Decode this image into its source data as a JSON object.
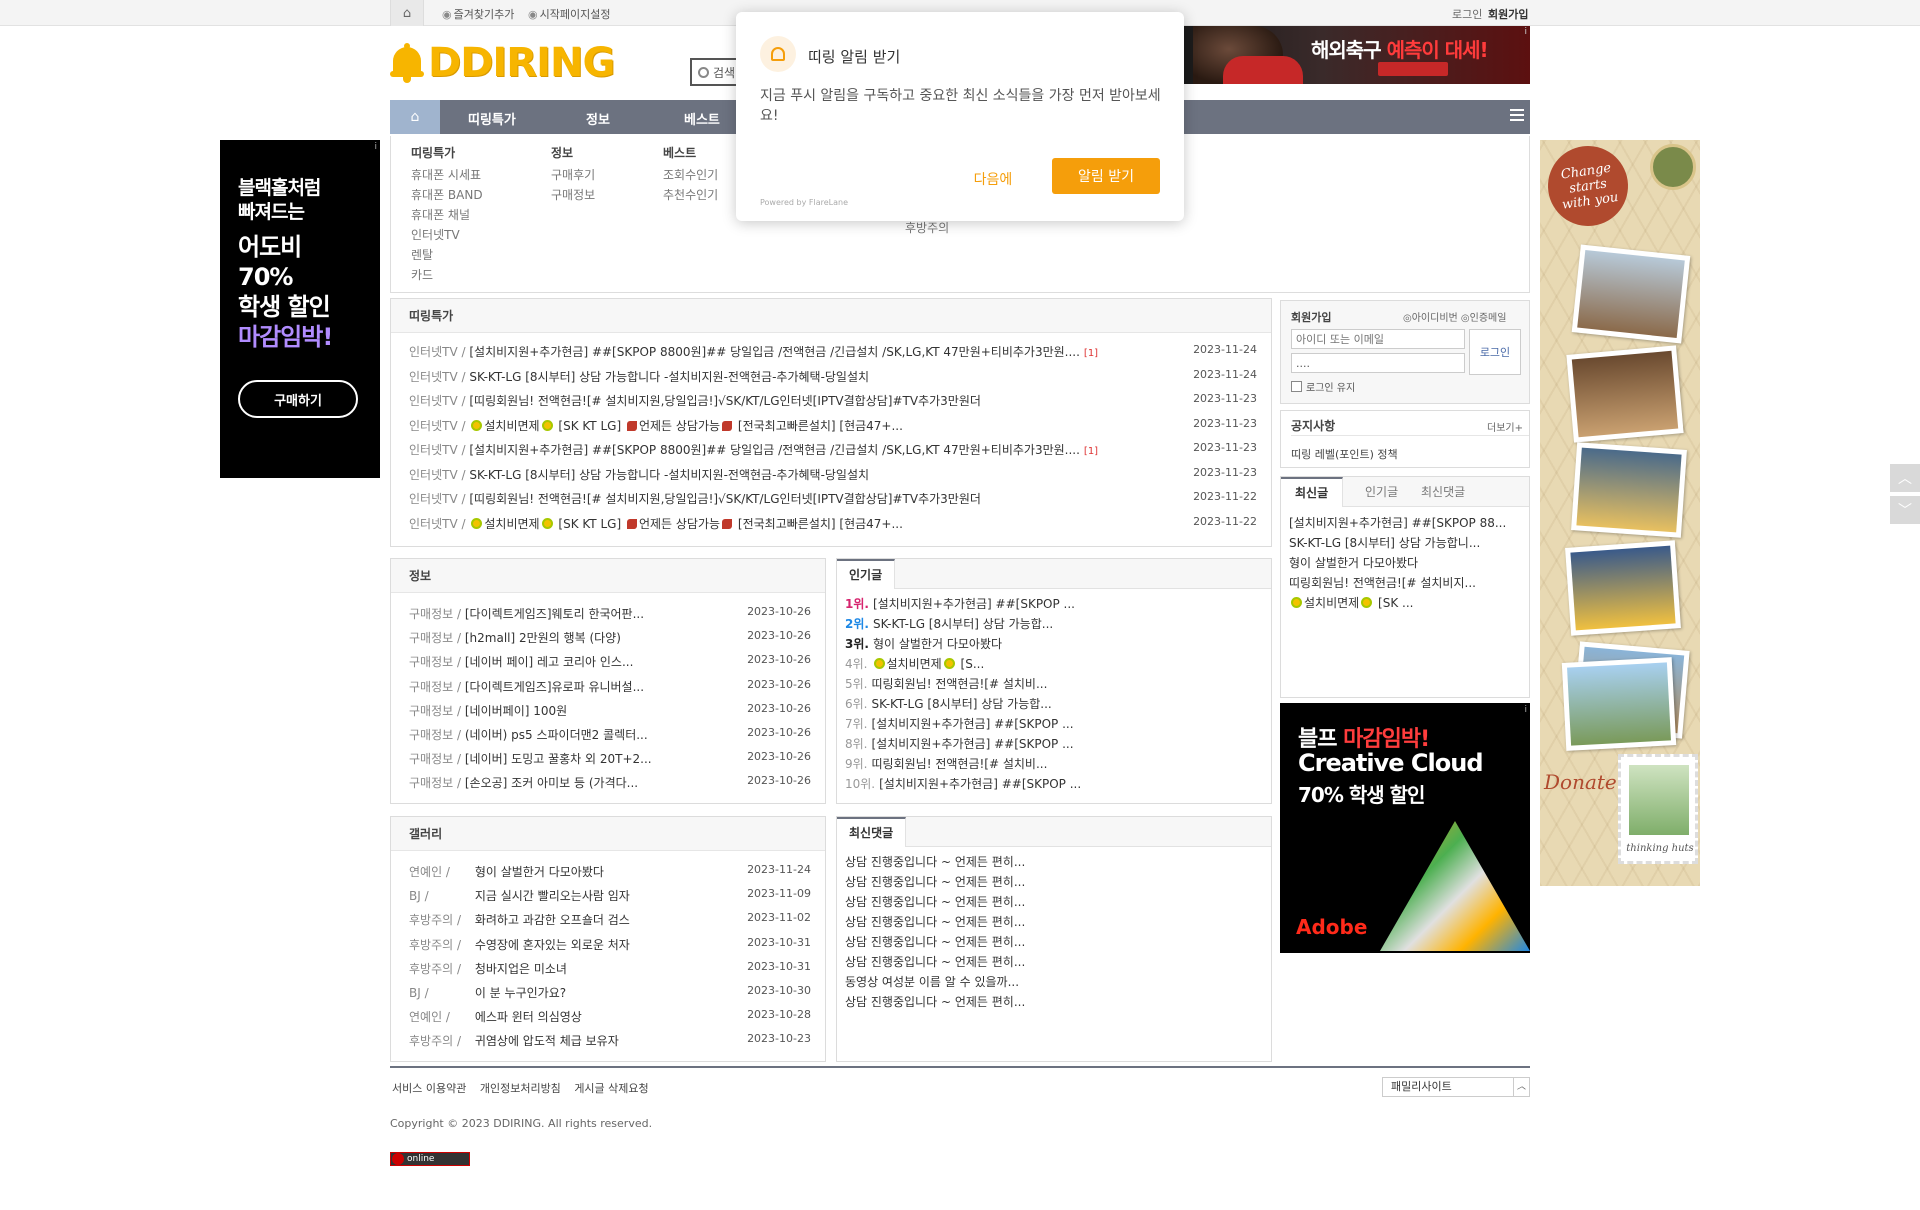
{
  "topbar": {
    "bookmark": "즐겨찾기추가",
    "startpage": "시작페이지설정",
    "login": "로그인",
    "join": "회원가입"
  },
  "logo": {
    "text": "DDIRING"
  },
  "search": {
    "placeholder": "검색"
  },
  "top_banner": {
    "text_white": "해외축구",
    "text_red": "예측이 대세!"
  },
  "nav": {
    "items": [
      "띠링특가",
      "정보",
      "베스트"
    ]
  },
  "mega_menu": {
    "columns": [
      {
        "heading": "띠링특가",
        "items": [
          "휴대폰 시세표",
          "휴대폰 BAND",
          "휴대폰 채널",
          "인터넷TV",
          "렌탈",
          "카드"
        ]
      },
      {
        "heading": "정보",
        "items": [
          "구매후기",
          "구매정보"
        ]
      },
      {
        "heading": "베스트",
        "items": [
          "조회수인기",
          "추천수인기"
        ]
      },
      {
        "heading": "",
        "items": [
          "후방주의"
        ]
      }
    ]
  },
  "popup": {
    "title": "띠링 알림 받기",
    "description": "지금 푸시 알림을 구독하고 중요한 최신 소식들을 가장 먼저 받아보세요!",
    "later": "다음에",
    "accept": "알림 받기",
    "powered": "Powered by FlareLane"
  },
  "ad_left": {
    "line1": "블랙홀처럼",
    "line2": "빠져드는",
    "line3": "어도비",
    "line4": "70%",
    "line5": "학생 할인",
    "line6": "마감임박!",
    "button": "구매하기"
  },
  "ad_right": {
    "seal": "Change starts with you",
    "donate": "Donate",
    "brand": "thinking huts"
  },
  "deals": {
    "title": "띠링특가",
    "rows": [
      {
        "cat": "인터넷TV /",
        "title": "[설치비지원+추가현금] ##[SKPOP 8800원]## 당일입금 /전액현금 /긴급설치 /SK,LG,KT 47만원+티비추가3만원....",
        "cmt": "[1]",
        "date": "2023-11-24"
      },
      {
        "cat": "인터넷TV /",
        "title": "SK-KT-LG [8시부터] 상담 가능합니다 -설치비지원-전액현금-추가혜택-당일설치",
        "cmt": "",
        "date": "2023-11-24"
      },
      {
        "cat": "인터넷TV /",
        "title": "[띠링회원님! 전액현금![# 설치비지원,당일입금!]√SK/KT/LG인터넷[IPTV결합상담]#TV추가3만원더",
        "cmt": "",
        "date": "2023-11-23"
      },
      {
        "cat": "인터넷TV /",
        "pre": "설치비면제",
        "title": "[SK KT LG]",
        "phone": "언제든 상담가능",
        "post": "[전국최고빠른설치] [현금47+...",
        "cmt": "",
        "date": "2023-11-23"
      },
      {
        "cat": "인터넷TV /",
        "title": "[설치비지원+추가현금] ##[SKPOP 8800원]## 당일입금 /전액현금 /긴급설치 /SK,LG,KT 47만원+티비추가3만원....",
        "cmt": "[1]",
        "date": "2023-11-23"
      },
      {
        "cat": "인터넷TV /",
        "title": "SK-KT-LG [8시부터] 상담 가능합니다 -설치비지원-전액현금-추가혜택-당일설치",
        "cmt": "",
        "date": "2023-11-23"
      },
      {
        "cat": "인터넷TV /",
        "title": "[띠링회원님! 전액현금![# 설치비지원,당일입금!]√SK/KT/LG인터넷[IPTV결합상담]#TV추가3만원더",
        "cmt": "",
        "date": "2023-11-22"
      },
      {
        "cat": "인터넷TV /",
        "pre": "설치비면제",
        "title": "[SK KT LG]",
        "phone": "언제든 상담가능",
        "post": "[전국최고빠른설치] [현금47+...",
        "cmt": "",
        "date": "2023-11-22"
      }
    ]
  },
  "info": {
    "title": "정보",
    "rows": [
      {
        "cat": "구매정보 /",
        "title": "[다이렉트게임즈]웨토리 한국어판...",
        "date": "2023-10-26"
      },
      {
        "cat": "구매정보 /",
        "title": "[h2mall] 2만원의 행복 (다양)",
        "date": "2023-10-26"
      },
      {
        "cat": "구매정보 /",
        "title": "[네이버 페이] 레고 코리아 인스...",
        "date": "2023-10-26"
      },
      {
        "cat": "구매정보 /",
        "title": "[다이렉트게임즈]유로파 유니버설...",
        "date": "2023-10-26"
      },
      {
        "cat": "구매정보 /",
        "title": "[네이버페이] 100원",
        "date": "2023-10-26"
      },
      {
        "cat": "구매정보 /",
        "title": "(네이버) ps5 스파이더맨2 콜렉터...",
        "date": "2023-10-26"
      },
      {
        "cat": "구매정보 /",
        "title": "[네이버] 도밍고 꿀홍차 외 20T+2...",
        "date": "2023-10-26"
      },
      {
        "cat": "구매정보 /",
        "title": "[손오공] 조커 아미보 등 (가격다...",
        "date": "2023-10-26"
      }
    ]
  },
  "popular": {
    "title": "인기글",
    "rows": [
      {
        "no": "1위.",
        "title": "[설치비지원+추가현금] ##[SKPOP ...",
        "color": "#d6246e"
      },
      {
        "no": "2위.",
        "title": "SK-KT-LG [8시부터] 상담 가능합...",
        "color": "#1e88e5"
      },
      {
        "no": "3위.",
        "title": "형이 살벌한거 다모아봤다",
        "color": "#222222"
      },
      {
        "no": "4위.",
        "pre": "설치비면제",
        "title": "[S...",
        "color": "#999999"
      },
      {
        "no": "5위.",
        "title": "띠링회원님! 전액현금![# 설치비...",
        "color": "#999999"
      },
      {
        "no": "6위.",
        "title": "SK-KT-LG [8시부터] 상담 가능합...",
        "color": "#999999"
      },
      {
        "no": "7위.",
        "title": "[설치비지원+추가현금] ##[SKPOP ...",
        "color": "#999999"
      },
      {
        "no": "8위.",
        "title": "[설치비지원+추가현금] ##[SKPOP ...",
        "color": "#999999"
      },
      {
        "no": "9위.",
        "title": "띠링회원님! 전액현금![# 설치비...",
        "color": "#999999"
      },
      {
        "no": "10위.",
        "title": "[설치비지원+추가현금] ##[SKPOP ...",
        "color": "#999999"
      }
    ]
  },
  "gallery": {
    "title": "갤러리",
    "rows": [
      {
        "cat": "연예인 /",
        "title": "형이 살벌한거 다모아봤다",
        "date": "2023-11-24"
      },
      {
        "cat": "BJ /",
        "title": "지금 실시간 빨리오는사람 임자",
        "date": "2023-11-09"
      },
      {
        "cat": "후방주의 /",
        "title": "화려하고 과감한 오프숄더 검스",
        "date": "2023-11-02"
      },
      {
        "cat": "후방주의 /",
        "title": "수영장에 혼자있는 외로운 처자",
        "date": "2023-10-31"
      },
      {
        "cat": "후방주의 /",
        "title": "청바지업은 미소녀",
        "date": "2023-10-31"
      },
      {
        "cat": "BJ /",
        "title": "이 분 누구인가요?",
        "date": "2023-10-30"
      },
      {
        "cat": "연예인 /",
        "title": "에스파 윈터 의심영상",
        "date": "2023-10-28"
      },
      {
        "cat": "후방주의 /",
        "title": "귀염상에 압도적 체급 보유자",
        "date": "2023-10-23"
      }
    ]
  },
  "recent_comments": {
    "title": "최신댓글",
    "rows": [
      "상담 진행중입니다 ~ 언제든 편히...",
      "상담 진행중입니다 ~ 언제든 편히...",
      "상담 진행중입니다 ~ 언제든 편히...",
      "상담 진행중입니다 ~ 언제든 편히...",
      "상담 진행중입니다 ~ 언제든 편히...",
      "상담 진행중입니다 ~ 언제든 편히...",
      "동영상 여성분 이름 알 수 있을까...",
      "상담 진행중입니다 ~ 언제든 편히..."
    ]
  },
  "login_box": {
    "title": "회원가입",
    "find_id": "아이디비번",
    "verify_email": "인증메일",
    "id_placeholder": "아이디 또는 이메일",
    "pw_value": "....",
    "button": "로그인",
    "keep": "로그인 유지"
  },
  "notice": {
    "title": "공지사항",
    "more": "더보기+",
    "item": "띠링 레벨(포인트) 정책"
  },
  "recent_box": {
    "tabs": [
      "최신글",
      "인기글",
      "최신댓글"
    ],
    "items": [
      "[설치비지원+추가현금] ##[SKPOP 88...",
      "SK-KT-LG [8시부터] 상담 가능합니...",
      "형이 살벌한거 다모아봤다",
      "띠링회원님! 전액현금![# 설치비지...",
      "[SK ..."
    ],
    "flower_item": "설치비면제"
  },
  "ad_cc": {
    "line1a": "블프 ",
    "line1b": "마감임박!",
    "line2": "Creative Cloud",
    "line3": "70% 학생 할인",
    "brand": "Adobe"
  },
  "footer": {
    "links": [
      "서비스 이용약관",
      "개인정보처리방침",
      "게시글 삭제요청"
    ],
    "family": "패밀리사이트",
    "copyright": "Copyright © 2023 DDIRING. All rights reserved.",
    "counter": "online"
  }
}
